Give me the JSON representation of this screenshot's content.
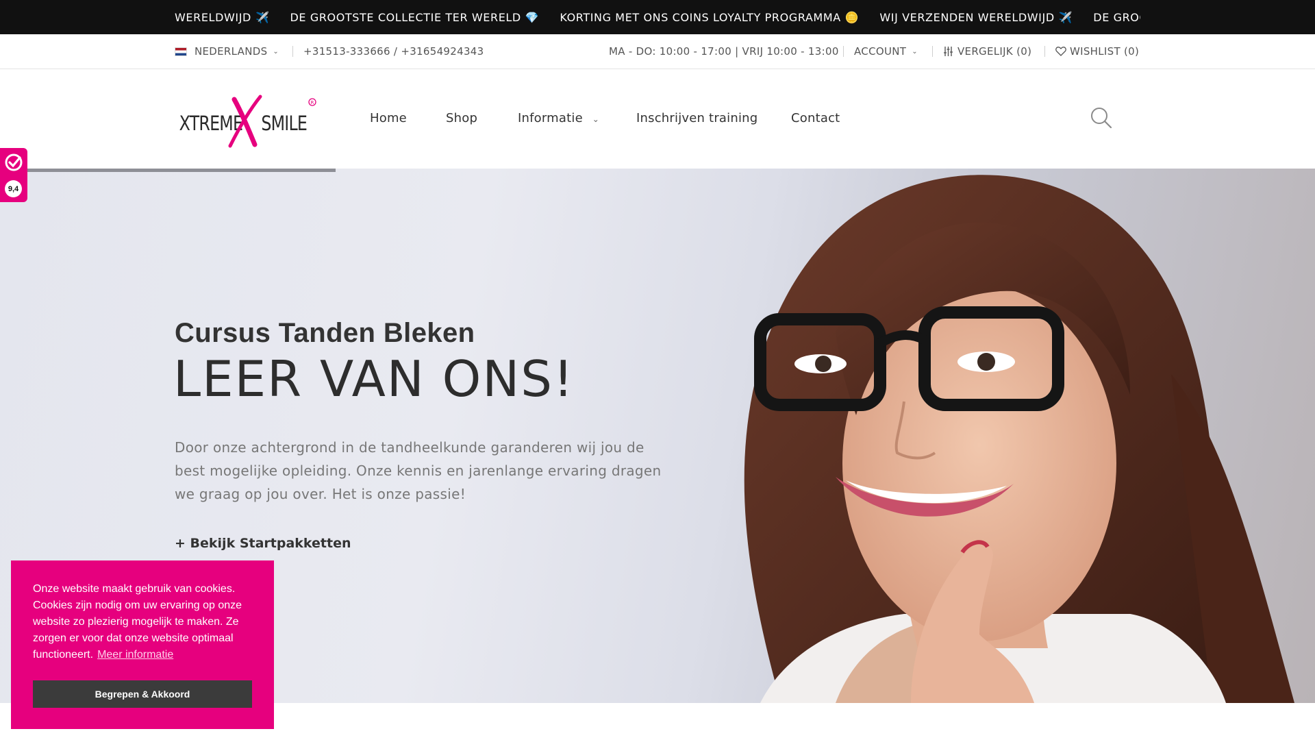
{
  "ticker": {
    "items": [
      {
        "text": "WERELDWIJD",
        "emoji": "✈️"
      },
      {
        "text": "DE GROOTSTE COLLECTIE TER WERELD",
        "emoji": "💎"
      },
      {
        "text": "KORTING MET ONS COINS LOYALTY PROGRAMMA",
        "emoji": "🪙"
      },
      {
        "text": "WIJ VERZENDEN WERELDWIJD",
        "emoji": "✈️"
      },
      {
        "text": "DE GROOTSTE COLLECTIE TER WERELD",
        "emoji": "💎"
      }
    ]
  },
  "topbar": {
    "language": "NEDERLANDS",
    "phone": "+31513-333666 / +31654924343",
    "hours": "MA - DO: 10:00 - 17:00 | VRIJ 10:00 - 13:00",
    "account": "ACCOUNT",
    "compare": "VERGELIJK (0)",
    "wishlist": "WISHLIST (0)"
  },
  "header": {
    "logo_text": "XTREMEXSMILE",
    "nav": [
      {
        "label": "Home"
      },
      {
        "label": "Shop"
      },
      {
        "label": "Informatie",
        "has_dropdown": true
      },
      {
        "label": "Inschrijven training"
      },
      {
        "label": "Contact"
      }
    ]
  },
  "hero": {
    "subtitle": "Cursus Tanden Bleken",
    "title": "LEER VAN ONS!",
    "text": "Door onze achtergrond in de tandheelkunde garanderen wij jou de best mogelijke opleiding. Onze kennis en jarenlange ervaring dragen we graag op jou over. Het is onze passie!",
    "cta": "+ Bekijk Startpakketten"
  },
  "review_badge": {
    "score": "9,4"
  },
  "cookie": {
    "text": "Onze website maakt gebruik van cookies. Cookies zijn nodig om uw ervaring op onze website zo plezierig mogelijk te maken. Ze zorgen er voor dat onze website optimaal functioneert.",
    "link": "Meer informatie",
    "button": "Begrepen & Akkoord"
  },
  "colors": {
    "brand_pink": "#e6007e",
    "ticker_bg": "#111111",
    "cookie_button": "#3b3b3b"
  },
  "icons": {
    "search": "search-icon",
    "compare": "sliders-icon",
    "wishlist": "heart-icon",
    "language": "flag-nl-icon",
    "review": "review-check-icon"
  }
}
